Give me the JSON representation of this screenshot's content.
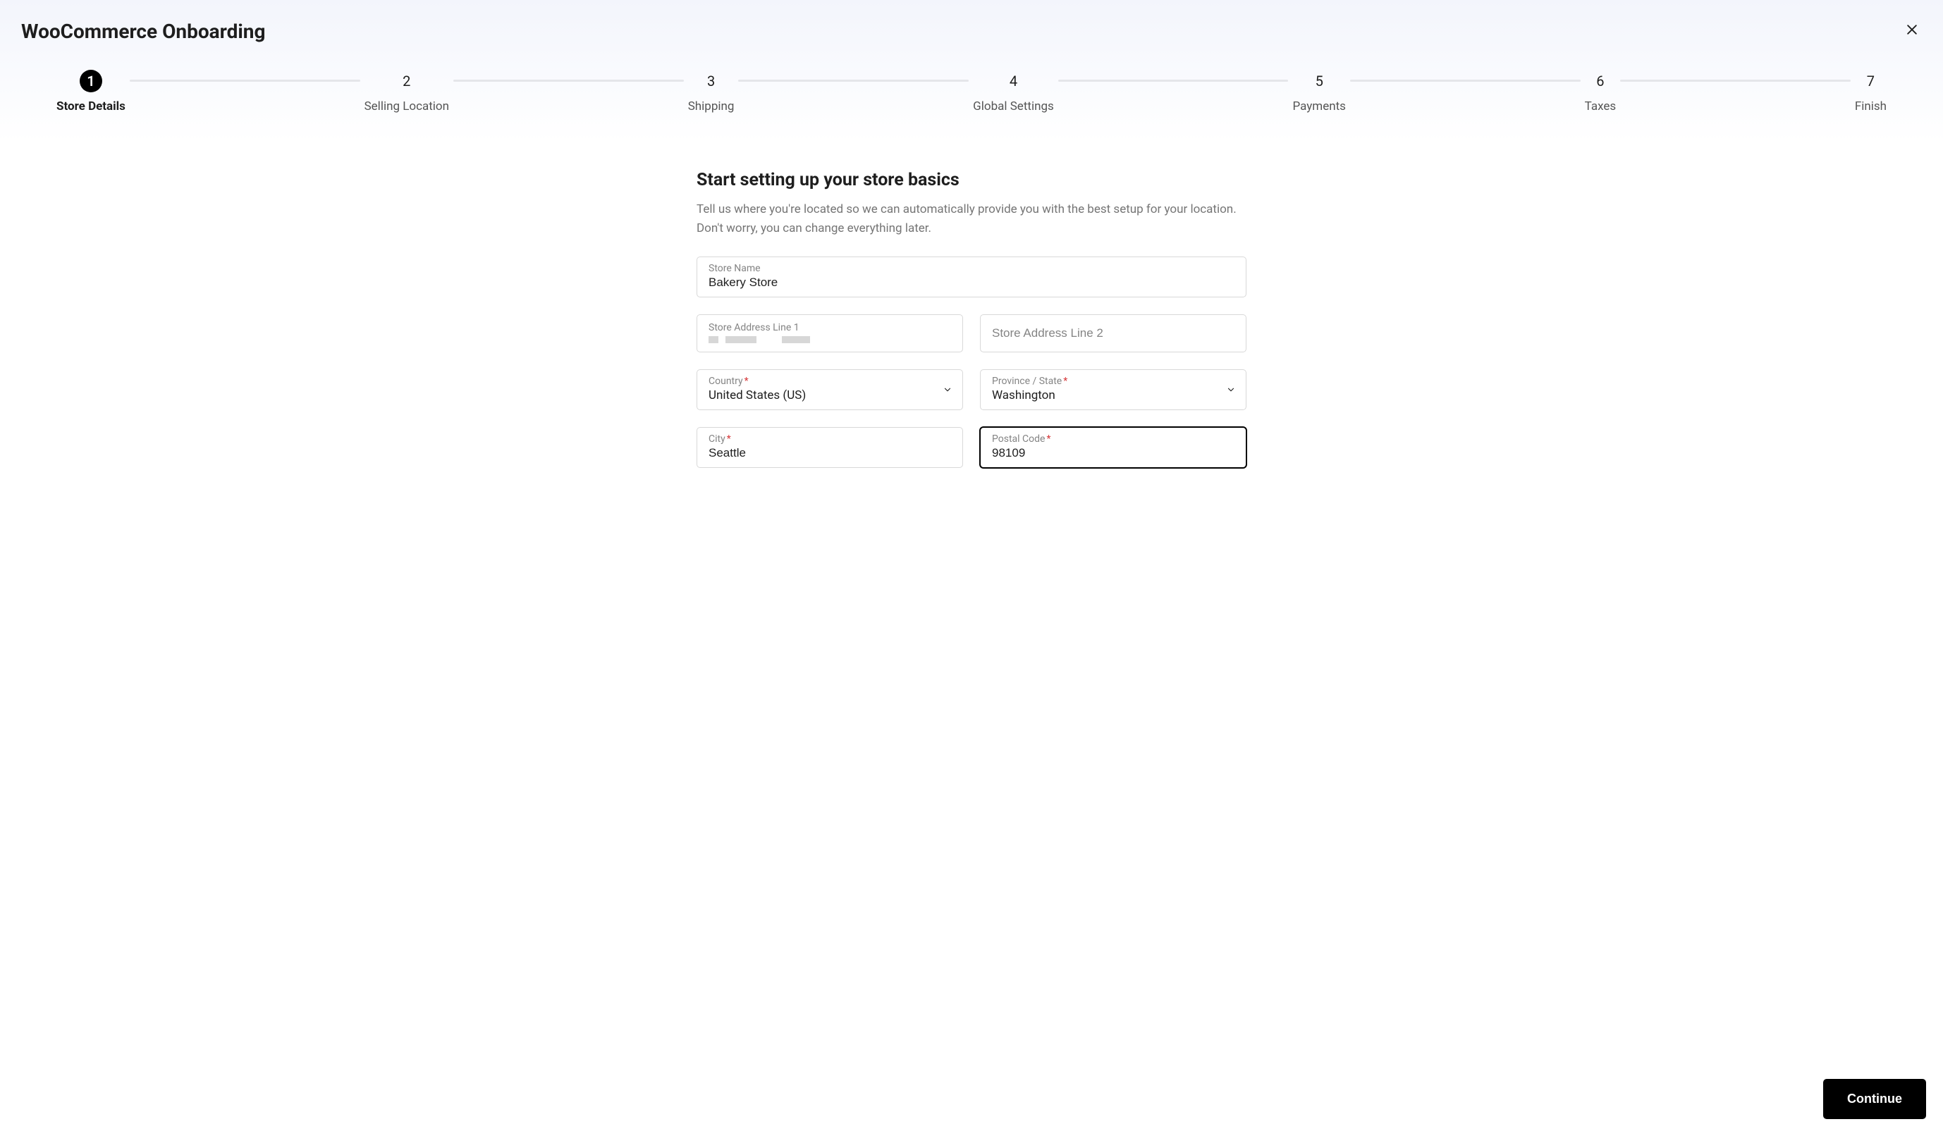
{
  "header": {
    "title": "WooCommerce Onboarding"
  },
  "stepper": {
    "steps": [
      {
        "num": "1",
        "label": "Store Details",
        "active": true
      },
      {
        "num": "2",
        "label": "Selling Location",
        "active": false
      },
      {
        "num": "3",
        "label": "Shipping",
        "active": false
      },
      {
        "num": "4",
        "label": "Global Settings",
        "active": false
      },
      {
        "num": "5",
        "label": "Payments",
        "active": false
      },
      {
        "num": "6",
        "label": "Taxes",
        "active": false
      },
      {
        "num": "7",
        "label": "Finish",
        "active": false
      }
    ]
  },
  "main": {
    "heading": "Start setting up your store basics",
    "description": "Tell us where you're located so we can automatically provide you with the best setup for your location. Don't worry, you can change everything later."
  },
  "form": {
    "store_name": {
      "label": "Store Name",
      "value": "Bakery Store"
    },
    "addr1": {
      "label": "Store Address Line 1",
      "value": ""
    },
    "addr2": {
      "placeholder": "Store Address Line 2",
      "value": ""
    },
    "country": {
      "label": "Country",
      "value": "United States (US)"
    },
    "province": {
      "label": "Province / State",
      "value": "Washington"
    },
    "city": {
      "label": "City",
      "value": "Seattle"
    },
    "postal": {
      "label": "Postal Code",
      "value": "98109"
    }
  },
  "footer": {
    "continue_label": "Continue"
  }
}
